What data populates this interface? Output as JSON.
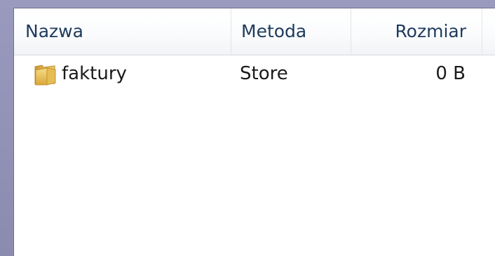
{
  "columns": {
    "name": "Nazwa",
    "method": "Metoda",
    "size": "Rozmiar"
  },
  "rows": [
    {
      "name": "faktury",
      "method": "Store",
      "size": "0 B",
      "icon": "folder-icon"
    }
  ],
  "colors": {
    "frame": "#8f8fb2",
    "header_text": "#1e3b5c",
    "folder": "#e8c25a"
  }
}
